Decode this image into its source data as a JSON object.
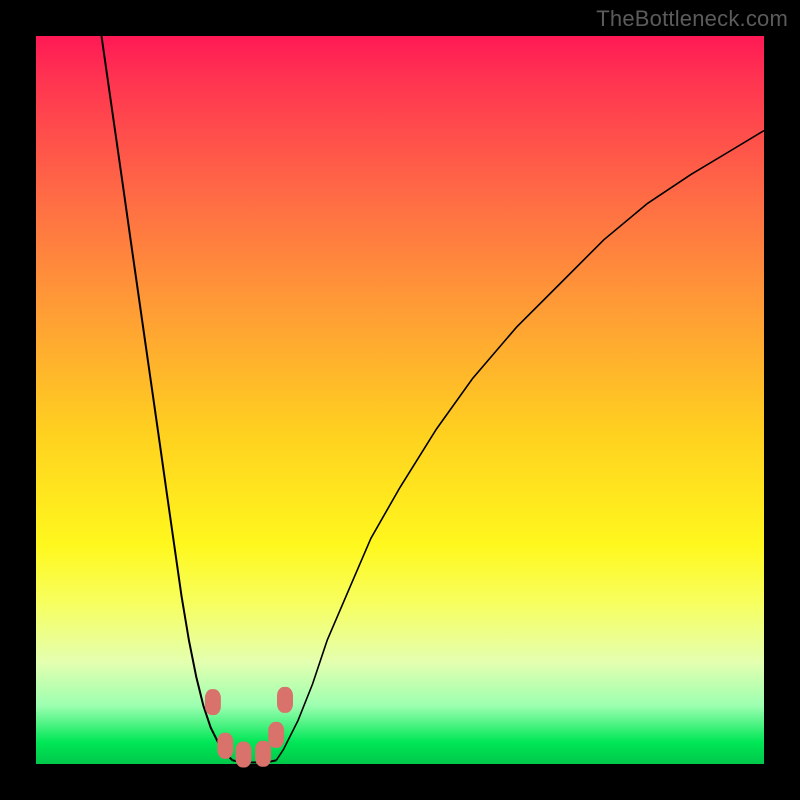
{
  "watermark": "TheBottleneck.com",
  "colors": {
    "frame": "#000000",
    "curve_stroke": "#000000",
    "marker_fill": "#d9726b",
    "marker_stroke": "#b95a53"
  },
  "chart_data": {
    "type": "line",
    "title": "",
    "xlabel": "",
    "ylabel": "",
    "xlim": [
      0,
      100
    ],
    "ylim": [
      0,
      100
    ],
    "grid": false,
    "curve_left": {
      "x": [
        9,
        10,
        11,
        12,
        13,
        14,
        15,
        16,
        17,
        18,
        19,
        20,
        21,
        22,
        23,
        24,
        25,
        26,
        27
      ],
      "y": [
        100,
        93,
        86,
        79,
        72,
        65,
        58,
        51,
        44,
        37,
        30,
        23,
        17,
        12,
        8,
        5,
        3,
        1.5,
        0.5
      ]
    },
    "curve_right": {
      "x": [
        33,
        34,
        36,
        38,
        40,
        43,
        46,
        50,
        55,
        60,
        66,
        72,
        78,
        84,
        90,
        95,
        100
      ],
      "y": [
        0.5,
        2,
        6,
        11,
        17,
        24,
        31,
        38,
        46,
        53,
        60,
        66,
        72,
        77,
        81,
        84,
        87
      ]
    },
    "valley_floor": {
      "x": [
        27,
        28,
        29,
        30,
        31,
        32,
        33
      ],
      "y": [
        0.5,
        0.3,
        0.2,
        0.2,
        0.2,
        0.3,
        0.5
      ]
    },
    "markers": [
      {
        "x": 24.3,
        "y": 8.5
      },
      {
        "x": 26.0,
        "y": 2.5
      },
      {
        "x": 28.5,
        "y": 1.3
      },
      {
        "x": 31.2,
        "y": 1.4
      },
      {
        "x": 33.0,
        "y": 4.0
      },
      {
        "x": 34.2,
        "y": 8.8
      }
    ]
  }
}
